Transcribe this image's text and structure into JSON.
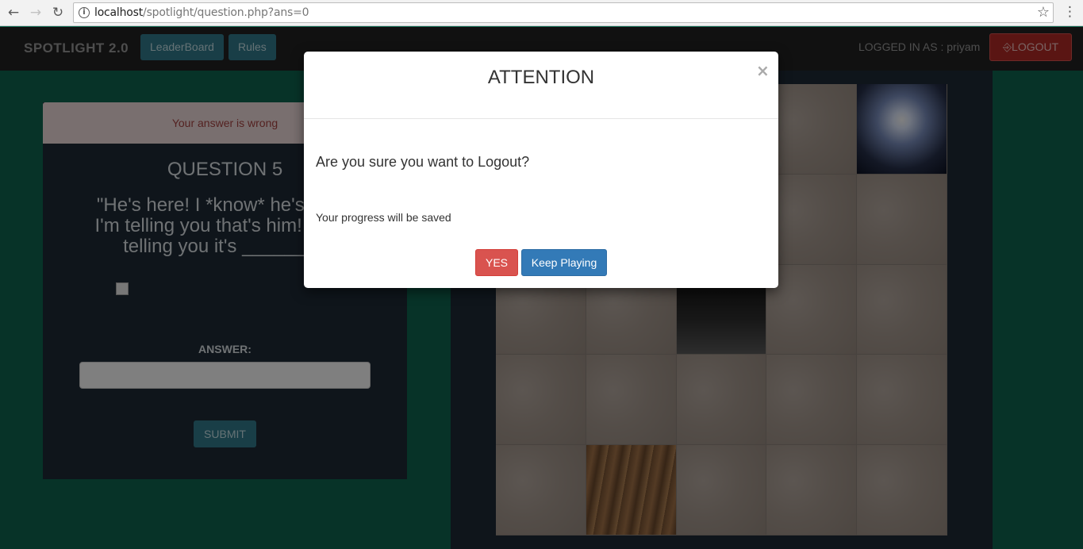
{
  "browser": {
    "url_host": "localhost",
    "url_path": "/spotlight/question.php?ans=0"
  },
  "navbar": {
    "brand": "SPOTLIGHT 2.0",
    "leaderboard_label": "LeaderBoard",
    "rules_label": "Rules",
    "logged_in_text": "LOGGED IN AS : priyam",
    "logout_label": "LOGOUT"
  },
  "question_panel": {
    "alert_text": "Your answer is wrong",
    "title": "QUESTION 5",
    "text_line1": "\"He's here! I *know* he's here!",
    "text_line2": "I'm telling you that's him! You h",
    "text_line3": "telling you it's ________",
    "answer_label": "ANSWER:",
    "answer_value": "",
    "submit_label": "SUBMIT"
  },
  "puzzle": {
    "tiles": [
      "stone",
      "stone",
      "stone",
      "stone",
      "light",
      "stone",
      "stone",
      "stone",
      "stone",
      "stone",
      "stone",
      "stone",
      "dark",
      "stone",
      "stone",
      "stone",
      "stone",
      "stone",
      "stone",
      "stone",
      "stone",
      "floor",
      "stone",
      "stone",
      "stone"
    ]
  },
  "modal": {
    "title": "ATTENTION",
    "close_glyph": "×",
    "question": "Are you sure you want to Logout?",
    "note": "Your progress will be saved",
    "yes_label": "YES",
    "keep_label": "Keep Playing"
  }
}
